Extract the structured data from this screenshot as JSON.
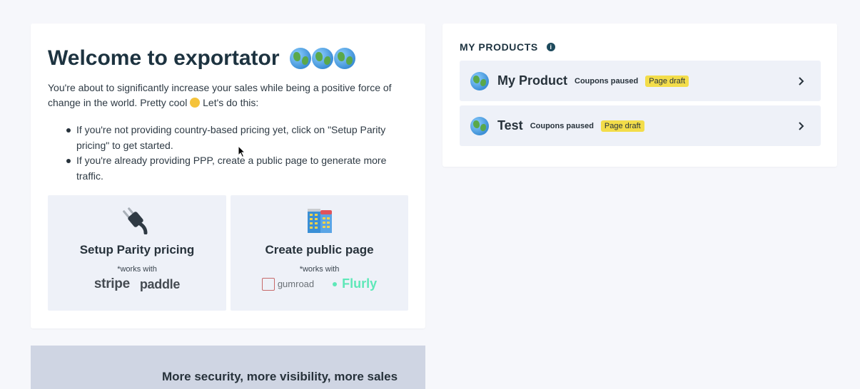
{
  "welcome": {
    "title": "Welcome to exportator",
    "intro_before": "You're about to significantly increase your sales while being a positive force of change in the world. Pretty cool",
    "intro_after": " Let's do this:",
    "bullets": [
      "If you're not providing country-based pricing yet, click on \"Setup Parity pricing\" to get started.",
      "If you're already providing PPP, create a public page to generate more traffic."
    ],
    "tiles": [
      {
        "title": "Setup Parity pricing",
        "works_with": "*works with",
        "logos": [
          "stripe",
          "paddle"
        ]
      },
      {
        "title": "Create public page",
        "works_with": "*works with",
        "logos": [
          "gumroad",
          "Flurly"
        ]
      }
    ]
  },
  "products": {
    "heading": "MY PRODUCTS",
    "items": [
      {
        "name": "My Product",
        "status": "Coupons paused",
        "badge": "Page draft"
      },
      {
        "name": "Test",
        "status": "Coupons paused",
        "badge": "Page draft"
      }
    ]
  },
  "banner": {
    "text": "More security, more visibility, more sales"
  },
  "icons": {
    "globe": "globe-icon",
    "wink": "winking-face-icon",
    "plug": "plug-icon",
    "building": "building-icon",
    "info": "info-icon",
    "chevron": "chevron-right-icon"
  },
  "colors": {
    "badge": "#f3dd4a",
    "tile_bg": "#eef1f8",
    "banner_bg": "#cfd5e3",
    "flurly": "#5ee8b8"
  }
}
